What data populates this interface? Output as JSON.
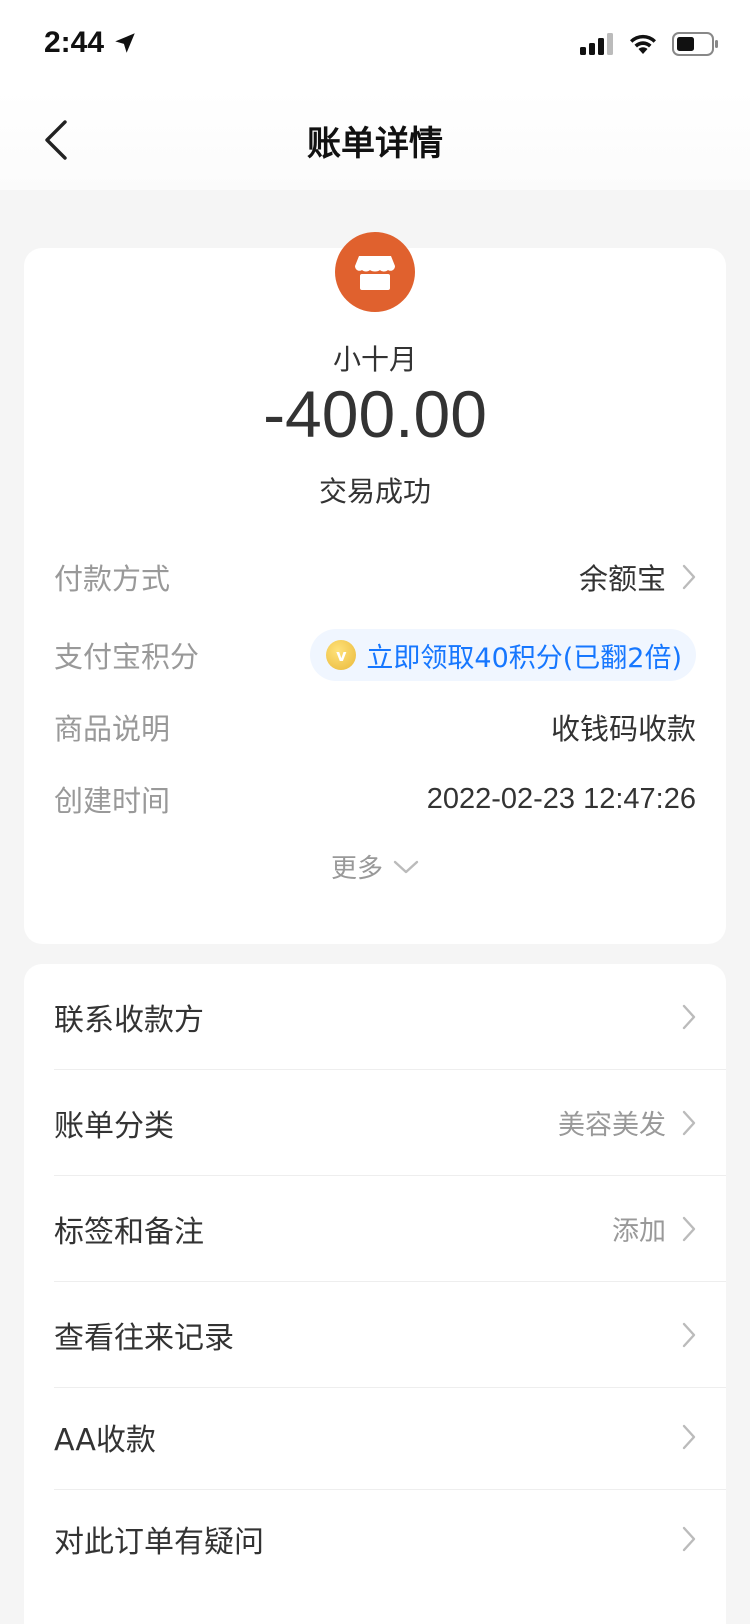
{
  "status_bar": {
    "time": "2:44"
  },
  "nav": {
    "title": "账单详情"
  },
  "summary": {
    "merchant_name": "小十月",
    "amount": "-400.00",
    "status": "交易成功",
    "brand_color": "#e0612e"
  },
  "details": {
    "payment_method_label": "付款方式",
    "payment_method_value": "余额宝",
    "points_label": "支付宝积分",
    "points_value": "立即领取40积分(已翻2倍)",
    "product_label": "商品说明",
    "product_value": "收钱码收款",
    "created_label": "创建时间",
    "created_value": "2022-02-23 12:47:26",
    "more_label": "更多"
  },
  "actions": [
    {
      "label": "联系收款方",
      "value": ""
    },
    {
      "label": "账单分类",
      "value": "美容美发"
    },
    {
      "label": "标签和备注",
      "value": "添加"
    },
    {
      "label": "查看往来记录",
      "value": ""
    },
    {
      "label": "AA收款",
      "value": ""
    },
    {
      "label": "对此订单有疑问",
      "value": ""
    }
  ],
  "colors": {
    "link": "#1677ff",
    "muted": "#999999",
    "text": "#333333"
  }
}
